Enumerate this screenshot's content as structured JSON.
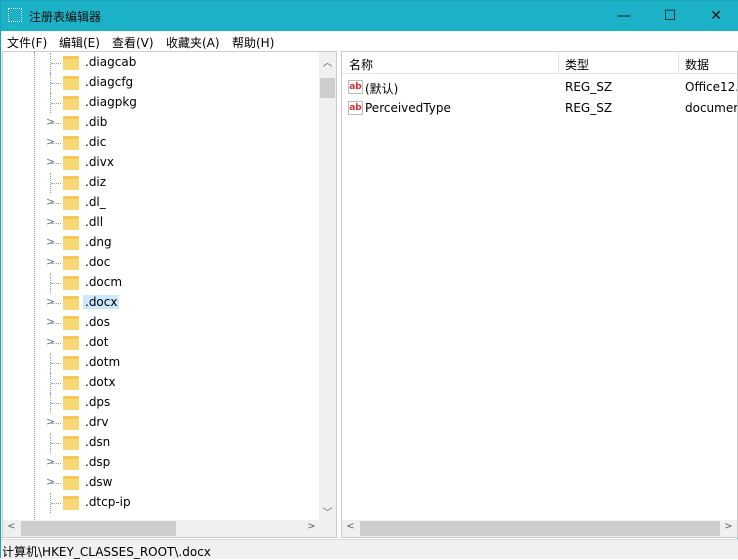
{
  "window": {
    "title": "注册表编辑器",
    "minimize": "—",
    "maximize": "☐",
    "close": "✕"
  },
  "menu": [
    "文件(F)",
    "编辑(E)",
    "查看(V)",
    "收藏夹(A)",
    "帮助(H)"
  ],
  "tree": [
    {
      "label": ".diagcab",
      "expandable": false
    },
    {
      "label": ".diagcfg",
      "expandable": false
    },
    {
      "label": ".diagpkg",
      "expandable": false
    },
    {
      "label": ".dib",
      "expandable": true
    },
    {
      "label": ".dic",
      "expandable": true
    },
    {
      "label": ".divx",
      "expandable": true
    },
    {
      "label": ".diz",
      "expandable": false
    },
    {
      "label": ".dl_",
      "expandable": true
    },
    {
      "label": ".dll",
      "expandable": true
    },
    {
      "label": ".dng",
      "expandable": true
    },
    {
      "label": ".doc",
      "expandable": true
    },
    {
      "label": ".docm",
      "expandable": false
    },
    {
      "label": ".docx",
      "expandable": true,
      "selected": true
    },
    {
      "label": ".dos",
      "expandable": true
    },
    {
      "label": ".dot",
      "expandable": true
    },
    {
      "label": ".dotm",
      "expandable": false
    },
    {
      "label": ".dotx",
      "expandable": false
    },
    {
      "label": ".dps",
      "expandable": false
    },
    {
      "label": ".drv",
      "expandable": true
    },
    {
      "label": ".dsn",
      "expandable": false
    },
    {
      "label": ".dsp",
      "expandable": true
    },
    {
      "label": ".dsw",
      "expandable": true
    },
    {
      "label": ".dtcp-ip",
      "expandable": false
    }
  ],
  "values": {
    "columns": [
      "名称",
      "类型",
      "数据"
    ],
    "rows": [
      {
        "name": "(默认)",
        "type": "REG_SZ",
        "data": "Office12."
      },
      {
        "name": "PerceivedType",
        "type": "REG_SZ",
        "data": "documer"
      }
    ]
  },
  "status": "计算机\\HKEY_CLASSES_ROOT\\.docx"
}
